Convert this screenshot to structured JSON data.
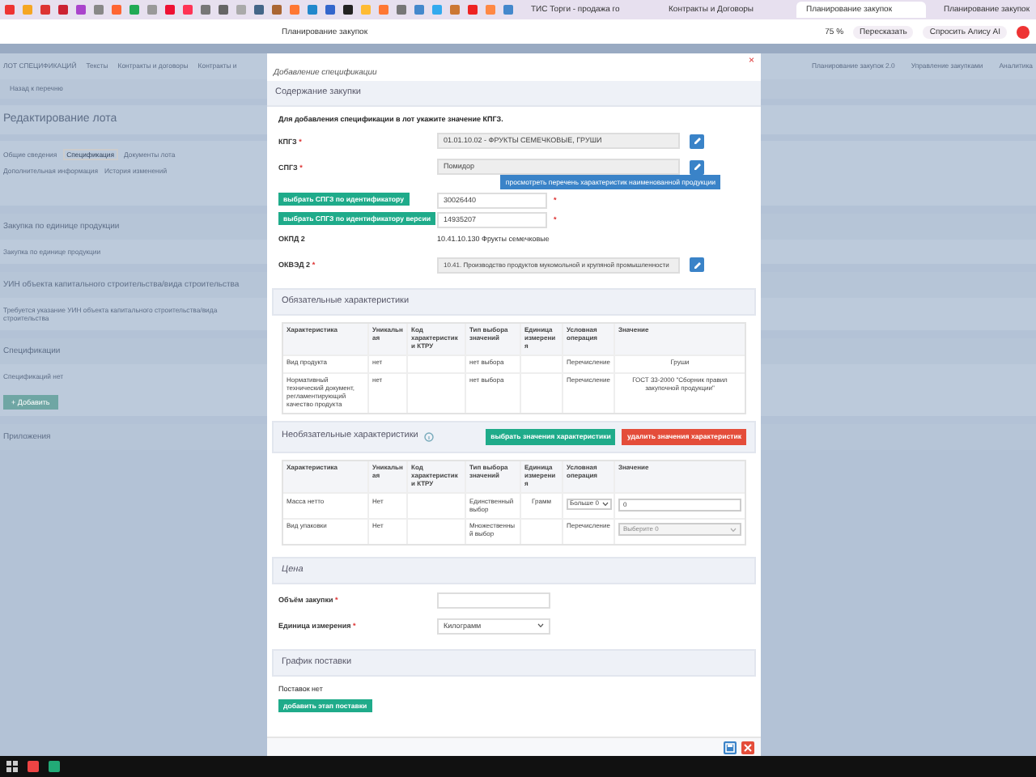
{
  "browser": {
    "tabs": [
      {
        "label": "ТИС Торги - продажа го",
        "selected": false
      },
      {
        "label": "Контракты и Договоры",
        "selected": false
      },
      {
        "label": "Планирование закупок",
        "selected": true
      },
      {
        "label": "Планирование закупок",
        "selected": false
      }
    ],
    "address": "Планирование закупок",
    "zoom": "75 %",
    "retell": "Пересказать",
    "ask": "Спросить Алису AI"
  },
  "background_page": {
    "nav": [
      "ЛОТ СПЕЦИФИКАЦИЙ",
      "Тексты",
      "Контракты и договоры",
      "Контракты и"
    ],
    "nav_right": [
      "Планирование закупок 2.0",
      "Управление закупками",
      "Аналитика"
    ],
    "breadcrumb": "Назад к перечню",
    "title": "Редактирование лота",
    "tabs": [
      {
        "label": "Общие сведения",
        "selected": false
      },
      {
        "label": "Спецификация",
        "selected": true
      },
      {
        "label": "Документы лота",
        "selected": false
      },
      {
        "label": "Дополнительная информация",
        "selected": false
      },
      {
        "label": "История изменений",
        "selected": false
      }
    ],
    "sections": [
      {
        "title": "Закупка по единице продукции",
        "text": "Закупка по единице продукции"
      },
      {
        "title": "УИН объекта капитального строительства/вида строительства",
        "text": "Требуется указание УИН объекта капитального строительства/вида строительства"
      },
      {
        "title": "Спецификации",
        "text": "Спецификаций нет",
        "button": "+ Добавить"
      },
      {
        "title": "Приложения"
      }
    ]
  },
  "modal": {
    "title": "Добавление спецификации",
    "close": "×",
    "content": {
      "title": "Содержание закупки",
      "note": "Для добавления спецификации в лот укажите значение КПГЗ.",
      "kpgz": {
        "label": "КПГЗ",
        "mark": "*",
        "value": "01.01.10.02 - ФРУКТЫ СЕМЕЧКОВЫЕ, ГРУШИ"
      },
      "spgz": {
        "label": "СПГЗ",
        "mark": "*",
        "value": "Помидор"
      },
      "view_button": "просмотреть перечень характеристик наименованной продукции",
      "by_id": {
        "button": "выбрать СПГЗ по идентификатору",
        "value": "30026440",
        "mark": "*"
      },
      "by_version": {
        "button": "выбрать СПГЗ по идентификатору версии",
        "value": "14935207",
        "mark": "*"
      },
      "okpd": {
        "label": "ОКПД 2",
        "value": "10.41.10.130 Фрукты семечковые"
      },
      "okved": {
        "label": "ОКВЭД 2",
        "mark": "*",
        "value": "10.41. Производство продуктов мукомольной и крупяной промышленности"
      }
    },
    "required_chars": {
      "title": "Обязательные характеристики",
      "columns": [
        "Характеристика",
        "Уникальная",
        "Код характеристики КТРУ",
        "Тип выбора значений",
        "Единица измерения",
        "Условная операция",
        "Значение"
      ],
      "rows": [
        [
          "Вид продукта",
          "нет",
          "",
          "нет выбора",
          "",
          "Перечисление",
          "Груши"
        ],
        [
          "Нормативный технический документ, регламентирующий качество продукта",
          "нет",
          "",
          "нет выбора",
          "",
          "Перечисление",
          "ГОСТ 33-2000 \"Сборник правил закупочной продукции\""
        ]
      ]
    },
    "optional_chars": {
      "title": "Необязательные характеристики",
      "select_button": "выбрать значения характеристики",
      "delete_button": "удалить значения характеристик",
      "columns": [
        "Характеристика",
        "Уникальная",
        "Код характеристики КТРУ",
        "Тип выбора значений",
        "Единица измерения",
        "Условная операция",
        "Значение"
      ],
      "rows": [
        {
          "cells": [
            "Масса нетто",
            "Нет",
            "",
            "Единственный выбор",
            "Грамм"
          ],
          "operation": {
            "kind": "select",
            "value": "Больше 0"
          },
          "value": {
            "kind": "input",
            "value": "0"
          }
        },
        {
          "cells": [
            "Вид упаковки",
            "Нет",
            "",
            "Множественный выбор",
            ""
          ],
          "operation": {
            "kind": "text",
            "value": "Перечисление"
          },
          "value": {
            "kind": "select",
            "placeholder": "Выберите 0"
          }
        }
      ]
    },
    "price": {
      "title": "Цена",
      "volume_label": "Объём закупки",
      "volume_mark": "*",
      "unit_label": "Единица измерения",
      "unit_mark": "*",
      "unit_value": "Килограмм"
    },
    "schedule": {
      "title": "График поставки",
      "empty": "Поставок нет",
      "add_button": "добавить этап поставки"
    }
  }
}
